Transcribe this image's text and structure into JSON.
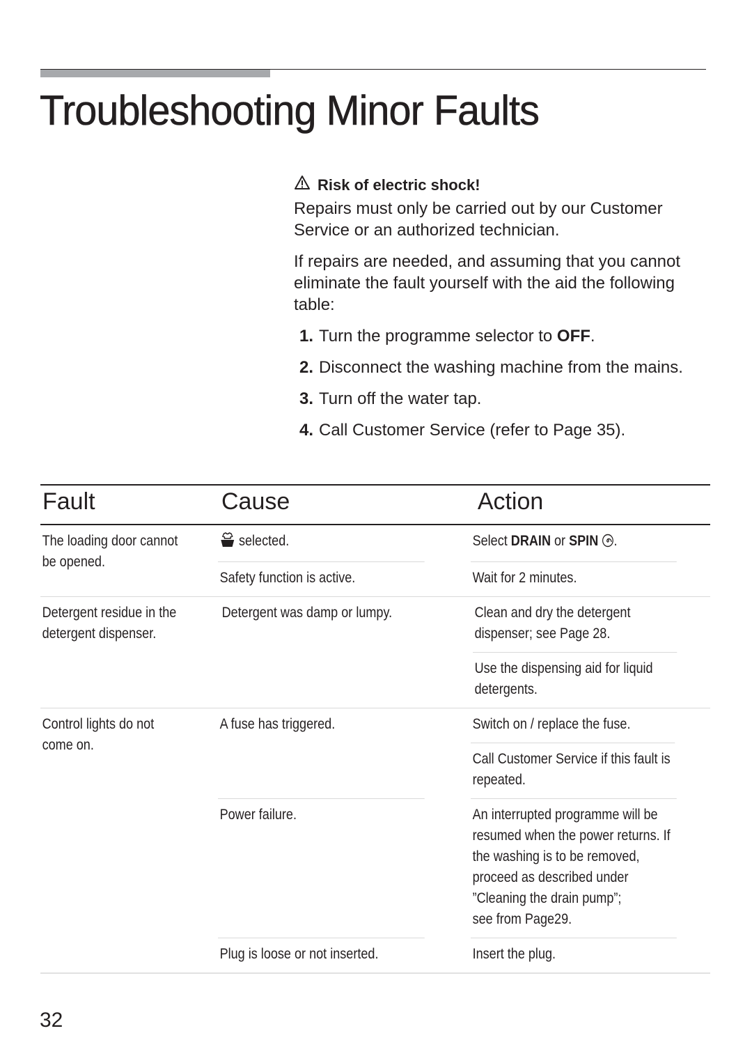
{
  "header": {
    "title": "Troubleshooting Minor Faults"
  },
  "warning": {
    "icon": "warning-triangle-icon",
    "heading": "Risk of electric shock!",
    "text": "Repairs must only be carried out by our Customer Service or an authorized technician."
  },
  "intro": "If repairs are needed, and assuming that you cannot eliminate the fault yourself with the aid the following table:",
  "steps": [
    {
      "num": "1.",
      "text": "Turn the programme selector to ",
      "bold": "OFF",
      "after": "."
    },
    {
      "num": "2.",
      "text": "Disconnect the washing machine from the mains."
    },
    {
      "num": "3.",
      "text": "Turn off the water tap."
    },
    {
      "num": "4.",
      "text": "Call Customer Service (refer to Page 35)."
    }
  ],
  "table": {
    "headers": {
      "fault": "Fault",
      "cause": "Cause",
      "action": "Action"
    },
    "rows": [
      {
        "fault": "The loading door cannot be opened.",
        "fault_lines": [
          "The loading door cannot",
          "be opened."
        ],
        "causes": [
          {
            "icon": "wash-tub-icon",
            "cause": "selected.",
            "actions": [
              {
                "parts": [
                  "Select ",
                  "DRAIN",
                  " or ",
                  "SPIN",
                  " "
                ],
                "icon": "spin-icon",
                "suffix": "."
              }
            ]
          },
          {
            "cause": "Safety function is active.",
            "actions": [
              {
                "text": "Wait for 2 minutes."
              }
            ]
          }
        ]
      },
      {
        "fault": "Detergent residue in the detergent dispenser.",
        "fault_lines": [
          "Detergent residue in the",
          "detergent dispenser."
        ],
        "causes": [
          {
            "cause": "Detergent was damp or lumpy.",
            "actions": [
              {
                "lines": [
                  "Clean and dry the detergent",
                  "dispenser; see Page 28."
                ]
              },
              {
                "lines": [
                  "Use the dispensing aid for liquid",
                  "detergents."
                ]
              }
            ]
          }
        ]
      },
      {
        "fault": "Control lights do not come on.",
        "fault_lines": [
          "Control lights do not",
          "come on."
        ],
        "causes": [
          {
            "cause": "A fuse has triggered.",
            "actions": [
              {
                "lines": [
                  "Switch on / replace the fuse."
                ]
              },
              {
                "lines": [
                  "Call Customer Service if this fault is",
                  "repeated."
                ]
              }
            ]
          },
          {
            "cause": "Power failure.",
            "actions": [
              {
                "lines": [
                  "An interrupted programme will be",
                  "resumed when the power returns. If",
                  "the washing is to be removed,",
                  "proceed as described under",
                  "”Cleaning the drain pump”;",
                  "see from Page29."
                ]
              }
            ]
          },
          {
            "cause": "Plug is loose or not inserted.",
            "actions": [
              {
                "lines": [
                  "Insert the plug."
                ]
              }
            ]
          }
        ]
      }
    ]
  },
  "footer": {
    "page_number": "32"
  }
}
